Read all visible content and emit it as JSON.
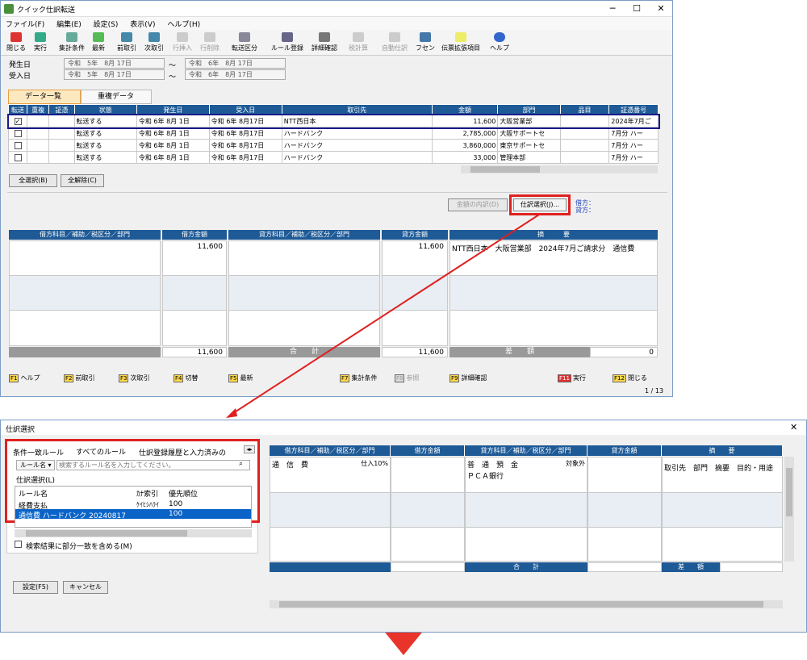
{
  "main_window": {
    "title": "クイック仕訳転送",
    "menu": [
      "ファイル(F)",
      "編集(E)",
      "設定(S)",
      "表示(V)",
      "ヘルプ(H)"
    ],
    "toolbar": {
      "close": "閉じる",
      "run": "実行",
      "aggregate": "集計条件",
      "latest": "最新",
      "prev": "前取引",
      "next": "次取引",
      "insert_row": "行挿入",
      "delete_row": "行削除",
      "transfer_type": "転送区分",
      "rule_register": "ルール登録",
      "detail": "詳細確認",
      "tax_calc": "税計算",
      "auto_journal": "自動仕訳",
      "fusen": "フセン",
      "voucher_ext": "伝票拡張項目",
      "help": "ヘルプ"
    },
    "filters": {
      "occur_label": "発生日",
      "receive_label": "受入日",
      "occur_from": "令和　5年　8月 17日",
      "occur_to": "令和　6年　8月 17日",
      "receive_from": "令和　5年　8月 17日",
      "receive_to": "令和　6年　8月 17日",
      "tilde": "～"
    },
    "tabs": {
      "data_list": "データ一覧",
      "duplicate": "重複データ"
    },
    "columns": [
      "転送",
      "重複",
      "証憑",
      "状態",
      "発生日",
      "受入日",
      "取引先",
      "金額",
      "部門",
      "品目",
      "証憑番号"
    ],
    "rows": [
      {
        "status": "転送する",
        "occur": "令和 6年 8月 1日",
        "receive": "令和 6年 8月17日",
        "partner": "NTT西日本",
        "amount": "11,600",
        "dept": "大阪営業部",
        "item": "",
        "voucher": "2024年7月ご"
      },
      {
        "status": "転送する",
        "occur": "令和 6年 8月 1日",
        "receive": "令和 6年 8月17日",
        "partner": "ハードバンク",
        "amount": "2,785,000",
        "dept": "大阪サポートセ",
        "item": "",
        "voucher": "7月分 ハー"
      },
      {
        "status": "転送する",
        "occur": "令和 6年 8月 1日",
        "receive": "令和 6年 8月17日",
        "partner": "ハードバンク",
        "amount": "3,860,000",
        "dept": "東京サポートセ",
        "item": "",
        "voucher": "7月分 ハー"
      },
      {
        "status": "転送する",
        "occur": "令和 6年 8月 1日",
        "receive": "令和 6年 8月17日",
        "partner": "ハードバンク",
        "amount": "33,000",
        "dept": "管理本部",
        "item": "",
        "voucher": "7月分 ハー"
      }
    ],
    "select_all": "全選択(B)",
    "deselect_all": "全解除(C)",
    "amount_breakdown": "金額の内訳(D)",
    "journal_select": "仕訳選択(J)...",
    "debit_label": "借方：",
    "credit_label": "貸方：",
    "journal_headers": [
      "借方科目／補助／税区分／部門",
      "借方金額",
      "貸方科目／補助／税区分／部門",
      "貸方金額",
      "摘　　　要"
    ],
    "debit_amount": "11,600",
    "credit_amount": "11,600",
    "summary": "NTT西日本　大阪営業部　2024年7月ご請求分　通信費",
    "total_label": "合　　計",
    "diff_label": "差　　額",
    "total_debit": "11,600",
    "total_credit": "11,600",
    "diff": "0",
    "fkeys": {
      "f1": "ヘルプ",
      "f2": "前取引",
      "f3": "次取引",
      "f4": "切替",
      "f5": "最新",
      "f7": "集計条件",
      "f8": "参照",
      "f9": "詳細確認",
      "f11": "実行",
      "f12": "閉じる"
    },
    "page_info": "1 / 13"
  },
  "dialog": {
    "title": "仕訳選択",
    "tabs": [
      "条件一致ルール",
      "すべてのルール",
      "仕訳登録履歴と入力済みの"
    ],
    "rule_dropdown": "ルール名",
    "search_placeholder": "検索するルール名を入力してください。",
    "list_label": "仕訳選択(L)",
    "list_headers": [
      "ルール名",
      "ｶﾅ索引",
      "優先順位"
    ],
    "list_rows": [
      {
        "name": "経費支払",
        "kana": "ｹｲﾋｼﾊﾗｲ",
        "priority": "100"
      },
      {
        "name": "通信費 ハードバンク 20240817",
        "kana": "",
        "priority": "100"
      }
    ],
    "partial_match": "検索結果に部分一致を含める(M)",
    "settings_button": "設定(F5)",
    "cancel_button": "キャンセル",
    "grid_headers": [
      "借方科目／補助／税区分／部門",
      "借方金額",
      "貸方科目／補助／税区分／部門",
      "貸方金額",
      "摘　　要"
    ],
    "debit_account": "通　信　費",
    "debit_tax": "仕入10%",
    "credit_account": "普　通　預　金",
    "credit_tax": "対象外",
    "credit_sub": "ＰＣＡ銀行",
    "summary_cols": "取引先　部門　摘要　目的・用途",
    "total_label": "合　　計",
    "diff_label": "差　　額"
  }
}
